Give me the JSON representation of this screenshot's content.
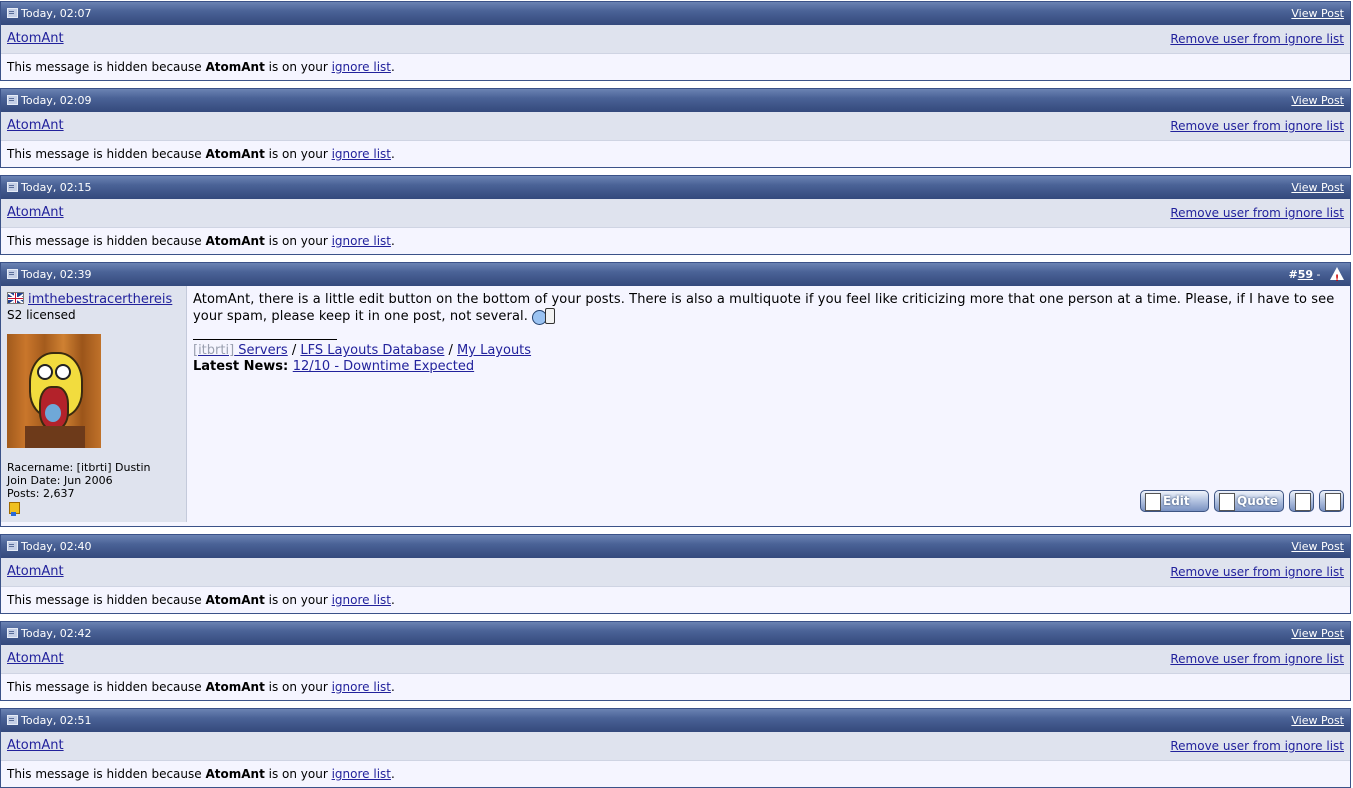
{
  "ignored_posts_top": [
    {
      "time": "Today, 02:07",
      "user": "AtomAnt",
      "view_post": "View Post",
      "remove": "Remove user from ignore list",
      "msg_prefix": "This message is hidden because ",
      "msg_user": "AtomAnt",
      "msg_mid": " is on your ",
      "msg_link": "ignore list",
      "msg_end": "."
    },
    {
      "time": "Today, 02:09",
      "user": "AtomAnt",
      "view_post": "View Post",
      "remove": "Remove user from ignore list",
      "msg_prefix": "This message is hidden because ",
      "msg_user": "AtomAnt",
      "msg_mid": " is on your ",
      "msg_link": "ignore list",
      "msg_end": "."
    },
    {
      "time": "Today, 02:15",
      "user": "AtomAnt",
      "view_post": "View Post",
      "remove": "Remove user from ignore list",
      "msg_prefix": "This message is hidden because ",
      "msg_user": "AtomAnt",
      "msg_mid": " is on your ",
      "msg_link": "ignore list",
      "msg_end": "."
    }
  ],
  "full_post": {
    "time": "Today, 02:39",
    "post_hash": "#",
    "post_number": "59",
    "post_sep": " - ",
    "username": "imthebestracerthereis",
    "user_title": "S2 licensed",
    "racername": "Racername: [itbrti] Dustin",
    "join_date": "Join Date: Jun 2006",
    "posts": "Posts: 2,637",
    "text": "AtomAnt, there is a little edit button on the bottom of your posts. There is also a multiquote if you feel like criticizing more that one person at a time. Please, if I have to see your spam, please keep it in one post, not several.",
    "sig_dim": "[itbrti]",
    "sig_servers": " Servers",
    "sig_slash1": " / ",
    "sig_layouts_db": "LFS Layouts Database",
    "sig_slash2": " / ",
    "sig_my_layouts": "My Layouts",
    "sig_news_label": "Latest News: ",
    "sig_news_link": "12/10 - Downtime Expected",
    "btn_edit": "Edit",
    "btn_quote": "Quote"
  },
  "ignored_posts_bottom": [
    {
      "time": "Today, 02:40",
      "user": "AtomAnt",
      "view_post": "View Post",
      "remove": "Remove user from ignore list",
      "msg_prefix": "This message is hidden because ",
      "msg_user": "AtomAnt",
      "msg_mid": " is on your ",
      "msg_link": "ignore list",
      "msg_end": "."
    },
    {
      "time": "Today, 02:42",
      "user": "AtomAnt",
      "view_post": "View Post",
      "remove": "Remove user from ignore list",
      "msg_prefix": "This message is hidden because ",
      "msg_user": "AtomAnt",
      "msg_mid": " is on your ",
      "msg_link": "ignore list",
      "msg_end": "."
    },
    {
      "time": "Today, 02:51",
      "user": "AtomAnt",
      "view_post": "View Post",
      "remove": "Remove user from ignore list",
      "msg_prefix": "This message is hidden because ",
      "msg_user": "AtomAnt",
      "msg_mid": " is on your ",
      "msg_link": "ignore list",
      "msg_end": "."
    }
  ],
  "colors": {
    "header_dark": "#34497c",
    "header_light": "#6b83b3",
    "user_row_bg": "#dfe3ee",
    "body_bg": "#f5f5ff",
    "link": "#22229c"
  }
}
